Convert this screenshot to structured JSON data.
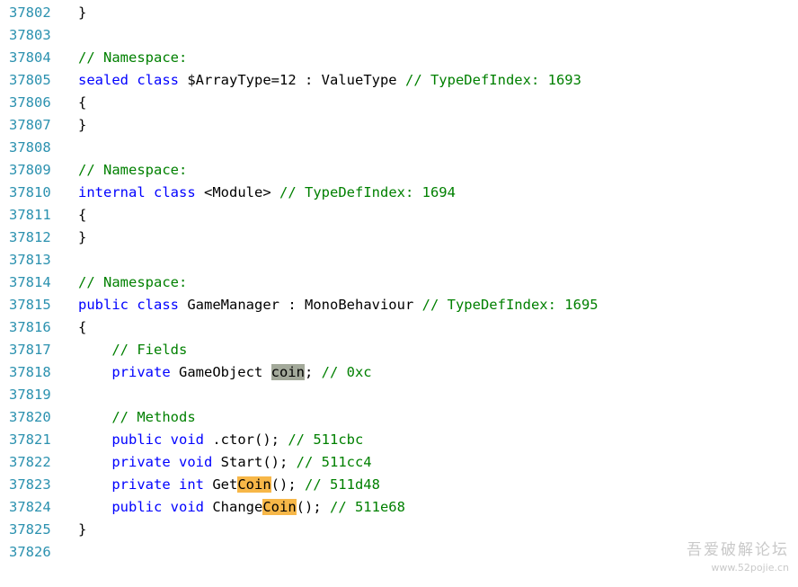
{
  "editor": {
    "lines": [
      {
        "num": "37802",
        "tokens": [
          {
            "t": "}",
            "c": "plain"
          }
        ]
      },
      {
        "num": "37803",
        "tokens": []
      },
      {
        "num": "37804",
        "tokens": [
          {
            "t": "// Namespace:",
            "c": "comment"
          }
        ]
      },
      {
        "num": "37805",
        "tokens": [
          {
            "t": "sealed",
            "c": "keyword"
          },
          {
            "t": " ",
            "c": "plain"
          },
          {
            "t": "class",
            "c": "keyword"
          },
          {
            "t": " $ArrayType=12 : ValueType ",
            "c": "plain"
          },
          {
            "t": "// TypeDefIndex: 1693",
            "c": "comment"
          }
        ]
      },
      {
        "num": "37806",
        "tokens": [
          {
            "t": "{",
            "c": "plain"
          }
        ]
      },
      {
        "num": "37807",
        "tokens": [
          {
            "t": "}",
            "c": "plain"
          }
        ]
      },
      {
        "num": "37808",
        "tokens": []
      },
      {
        "num": "37809",
        "tokens": [
          {
            "t": "// Namespace:",
            "c": "comment"
          }
        ]
      },
      {
        "num": "37810",
        "tokens": [
          {
            "t": "internal",
            "c": "keyword"
          },
          {
            "t": " ",
            "c": "plain"
          },
          {
            "t": "class",
            "c": "keyword"
          },
          {
            "t": " <Module> ",
            "c": "plain"
          },
          {
            "t": "// TypeDefIndex: 1694",
            "c": "comment"
          }
        ]
      },
      {
        "num": "37811",
        "tokens": [
          {
            "t": "{",
            "c": "plain"
          }
        ]
      },
      {
        "num": "37812",
        "tokens": [
          {
            "t": "}",
            "c": "plain"
          }
        ]
      },
      {
        "num": "37813",
        "tokens": []
      },
      {
        "num": "37814",
        "tokens": [
          {
            "t": "// Namespace:",
            "c": "comment"
          }
        ]
      },
      {
        "num": "37815",
        "tokens": [
          {
            "t": "public",
            "c": "keyword"
          },
          {
            "t": " ",
            "c": "plain"
          },
          {
            "t": "class",
            "c": "keyword"
          },
          {
            "t": " GameManager : MonoBehaviour ",
            "c": "plain"
          },
          {
            "t": "// TypeDefIndex: 1695",
            "c": "comment"
          }
        ]
      },
      {
        "num": "37816",
        "tokens": [
          {
            "t": "{",
            "c": "plain"
          }
        ]
      },
      {
        "num": "37817",
        "tokens": [
          {
            "t": "    ",
            "c": "plain"
          },
          {
            "t": "// Fields",
            "c": "comment"
          }
        ]
      },
      {
        "num": "37818",
        "tokens": [
          {
            "t": "    ",
            "c": "plain"
          },
          {
            "t": "private",
            "c": "keyword"
          },
          {
            "t": " GameObject ",
            "c": "plain"
          },
          {
            "t": "coin",
            "c": "plain",
            "hl": "gray"
          },
          {
            "t": "; ",
            "c": "plain"
          },
          {
            "t": "// 0xc",
            "c": "comment"
          }
        ]
      },
      {
        "num": "37819",
        "tokens": []
      },
      {
        "num": "37820",
        "tokens": [
          {
            "t": "    ",
            "c": "plain"
          },
          {
            "t": "// Methods",
            "c": "comment"
          }
        ]
      },
      {
        "num": "37821",
        "tokens": [
          {
            "t": "    ",
            "c": "plain"
          },
          {
            "t": "public",
            "c": "keyword"
          },
          {
            "t": " ",
            "c": "plain"
          },
          {
            "t": "void",
            "c": "keyword"
          },
          {
            "t": " .ctor(); ",
            "c": "plain"
          },
          {
            "t": "// 511cbc",
            "c": "comment"
          }
        ]
      },
      {
        "num": "37822",
        "tokens": [
          {
            "t": "    ",
            "c": "plain"
          },
          {
            "t": "private",
            "c": "keyword"
          },
          {
            "t": " ",
            "c": "plain"
          },
          {
            "t": "void",
            "c": "keyword"
          },
          {
            "t": " Start(); ",
            "c": "plain"
          },
          {
            "t": "// 511cc4",
            "c": "comment"
          }
        ]
      },
      {
        "num": "37823",
        "tokens": [
          {
            "t": "    ",
            "c": "plain"
          },
          {
            "t": "private",
            "c": "keyword"
          },
          {
            "t": " ",
            "c": "plain"
          },
          {
            "t": "int",
            "c": "keyword"
          },
          {
            "t": " Get",
            "c": "plain"
          },
          {
            "t": "Coin",
            "c": "plain",
            "hl": "orange"
          },
          {
            "t": "(); ",
            "c": "plain"
          },
          {
            "t": "// 511d48",
            "c": "comment"
          }
        ]
      },
      {
        "num": "37824",
        "tokens": [
          {
            "t": "    ",
            "c": "plain"
          },
          {
            "t": "public",
            "c": "keyword"
          },
          {
            "t": " ",
            "c": "plain"
          },
          {
            "t": "void",
            "c": "keyword"
          },
          {
            "t": " Change",
            "c": "plain"
          },
          {
            "t": "Coin",
            "c": "plain",
            "hl": "orange"
          },
          {
            "t": "(); ",
            "c": "plain"
          },
          {
            "t": "// 511e68",
            "c": "comment"
          }
        ]
      },
      {
        "num": "37825",
        "tokens": [
          {
            "t": "}",
            "c": "plain"
          }
        ]
      },
      {
        "num": "37826",
        "tokens": []
      }
    ]
  },
  "colors": {
    "line_number": "#2b91af",
    "keyword": "#0000ff",
    "comment": "#008000",
    "text": "#000000",
    "highlight_selection": "#a3a99a",
    "highlight_match": "#f7b748"
  },
  "watermark": {
    "text": "吾爱破解论坛",
    "url": "www.52pojie.cn"
  }
}
